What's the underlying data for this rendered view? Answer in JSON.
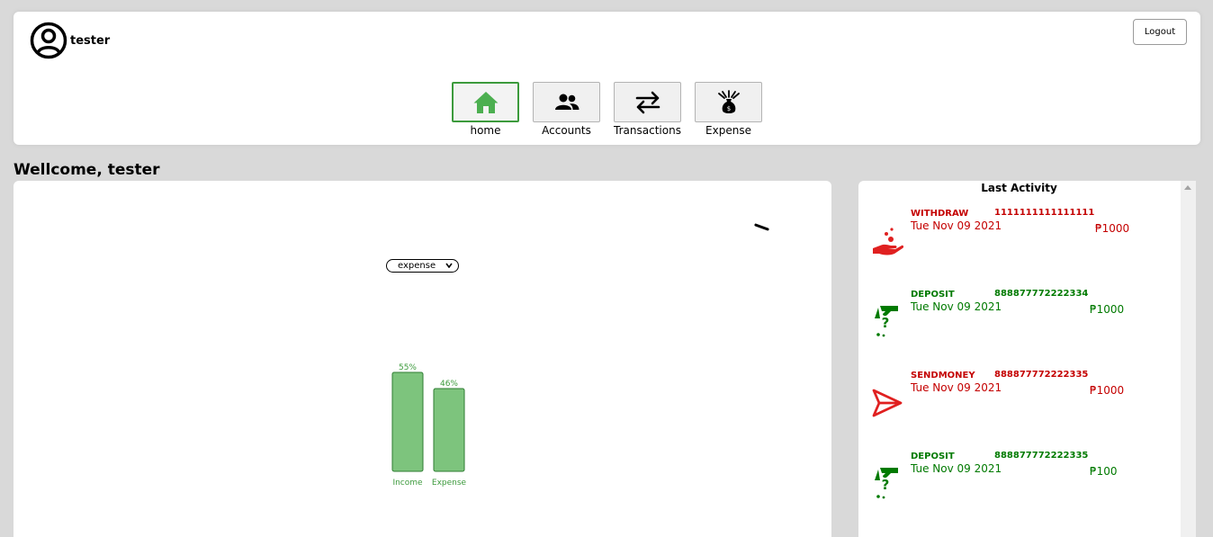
{
  "header": {
    "username": "tester",
    "logout_label": "Logout",
    "nav": [
      {
        "label": "home",
        "icon": "home-icon",
        "active": true
      },
      {
        "label": "Accounts",
        "icon": "users-icon",
        "active": false
      },
      {
        "label": "Transactions",
        "icon": "transfer-arrows-icon",
        "active": false
      },
      {
        "label": "Expense",
        "icon": "money-bag-icon",
        "active": false
      }
    ]
  },
  "welcome": "Wellcome, tester",
  "chart": {
    "select_value": "expense"
  },
  "chart_data": {
    "type": "bar",
    "categories": [
      "Income",
      "Expense"
    ],
    "values": [
      55,
      46
    ],
    "data_labels": [
      "55%",
      "46%"
    ],
    "bar_color": "#7dc47d",
    "label_color": "#3c9a3c"
  },
  "activity": {
    "title": "Last Activity",
    "items": [
      {
        "type": "WITHDRAW",
        "date": "Tue Nov 09 2021",
        "account": "1111111111111111",
        "amount": "₱1000",
        "color": "#c40000",
        "icon": "withdraw-hand-icon"
      },
      {
        "type": "DEPOSIT",
        "date": "Tue Nov 09 2021",
        "account": "888877772222334",
        "amount": "₱1000",
        "color": "#007a00",
        "icon": "deposit-hand-icon"
      },
      {
        "type": "SENDMONEY",
        "date": "Tue Nov 09 2021",
        "account": "888877772222335",
        "amount": "₱1000",
        "color": "#c40000",
        "icon": "send-icon"
      },
      {
        "type": "DEPOSIT",
        "date": "Tue Nov 09 2021",
        "account": "888877772222335",
        "amount": "₱100",
        "color": "#007a00",
        "icon": "deposit-hand-icon"
      }
    ]
  }
}
